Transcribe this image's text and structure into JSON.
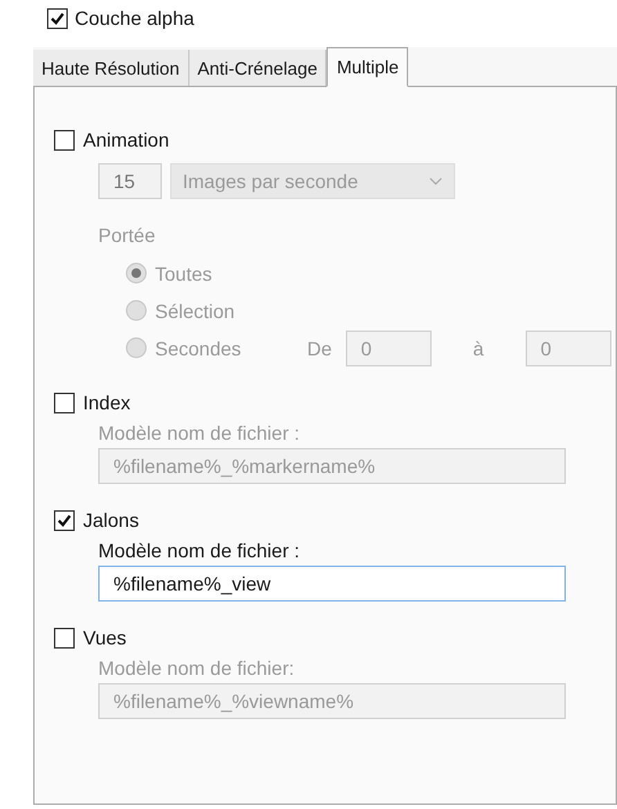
{
  "alpha_layer": {
    "label": "Couche alpha",
    "checked": true
  },
  "tabs": [
    {
      "label": "Haute Résolution",
      "selected": false
    },
    {
      "label": "Anti-Crénelage",
      "selected": false
    },
    {
      "label": "Multiple",
      "selected": true
    }
  ],
  "animation": {
    "label": "Animation",
    "checked": false,
    "rate_value": "15",
    "rate_unit": "Images par seconde",
    "range_label": "Portée",
    "range_options": [
      {
        "label": "Toutes",
        "selected": true
      },
      {
        "label": "Sélection",
        "selected": false
      },
      {
        "label": "Secondes",
        "selected": false
      }
    ],
    "from_label": "De",
    "from_value": "0",
    "to_label": "à",
    "to_value": "0"
  },
  "outputs": [
    {
      "label": "Index",
      "checked": false,
      "field_label": "Modèle nom de fichier :",
      "value": "%filename%_%markername%"
    },
    {
      "label": "Jalons",
      "checked": true,
      "field_label": "Modèle nom de fichier :",
      "value": "%filename%_view"
    },
    {
      "label": "Vues",
      "checked": false,
      "field_label": "Modèle nom de fichier:",
      "value": "%filename%_%viewname%"
    }
  ]
}
